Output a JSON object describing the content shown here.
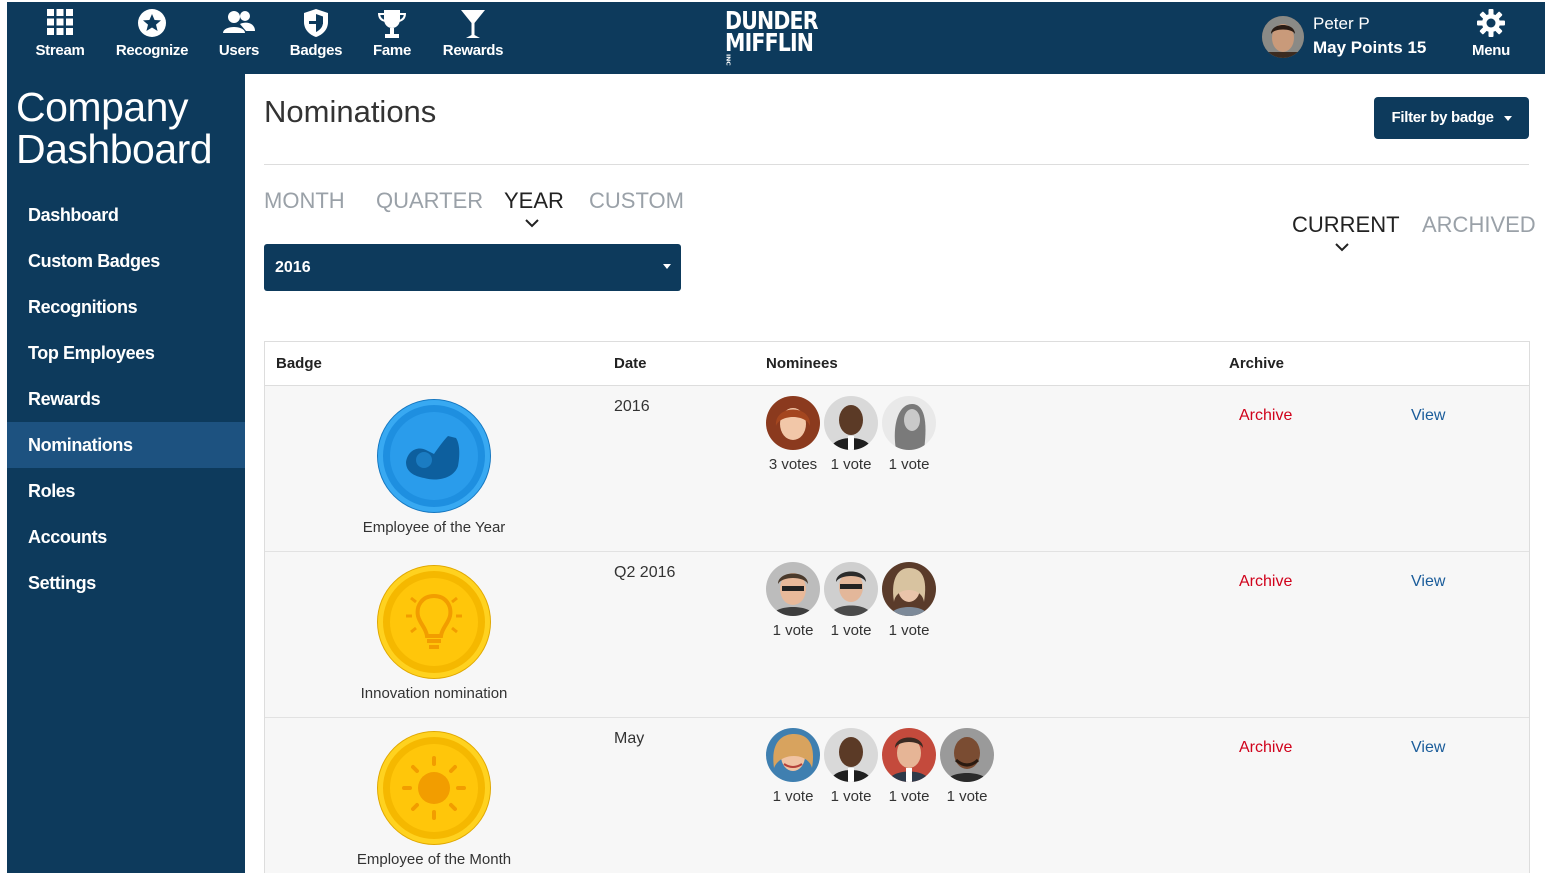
{
  "nav": {
    "items": [
      {
        "label": "Stream",
        "icon": "grid-icon"
      },
      {
        "label": "Recognize",
        "icon": "star-icon"
      },
      {
        "label": "Users",
        "icon": "users-icon"
      },
      {
        "label": "Badges",
        "icon": "shield-icon"
      },
      {
        "label": "Fame",
        "icon": "trophy-icon"
      },
      {
        "label": "Rewards",
        "icon": "cocktail-icon"
      }
    ],
    "logo_line1": "DUNDER",
    "logo_line2": "MIFFLIN",
    "logo_mark": "INC",
    "user_name": "Peter P",
    "user_points": "May Points 15",
    "menu_label": "Menu"
  },
  "sidebar": {
    "title_line1": "Company",
    "title_line2": "Dashboard",
    "items": [
      {
        "label": "Dashboard"
      },
      {
        "label": "Custom Badges"
      },
      {
        "label": "Recognitions"
      },
      {
        "label": "Top Employees"
      },
      {
        "label": "Rewards"
      },
      {
        "label": "Nominations"
      },
      {
        "label": "Roles"
      },
      {
        "label": "Accounts"
      },
      {
        "label": "Settings"
      }
    ],
    "active": "Nominations"
  },
  "main": {
    "title": "Nominations",
    "filter_label": "Filter by badge",
    "period_tabs": [
      "MONTH",
      "QUARTER",
      "YEAR",
      "CUSTOM"
    ],
    "period_active": "YEAR",
    "year_value": "2016",
    "status_tabs": [
      "CURRENT",
      "ARCHIVED"
    ],
    "status_active": "CURRENT"
  },
  "table": {
    "headers": {
      "badge": "Badge",
      "date": "Date",
      "nominees": "Nominees",
      "archive": "Archive"
    },
    "rows": [
      {
        "badge": "Employee of the Year",
        "badge_icon": "flexed-arm-icon",
        "badge_color": "#1e8fe0",
        "date": "2016",
        "nominees": [
          "3 votes",
          "1 vote",
          "1 vote"
        ],
        "archive": "Archive",
        "view": "View"
      },
      {
        "badge": "Innovation nomination",
        "badge_icon": "lightbulb-icon",
        "badge_color": "#f5b800",
        "date": "Q2 2016",
        "nominees": [
          "1 vote",
          "1 vote",
          "1 vote"
        ],
        "archive": "Archive",
        "view": "View"
      },
      {
        "badge": "Employee of the Month",
        "badge_icon": "sun-icon",
        "badge_color": "#f5b800",
        "date": "May",
        "nominees": [
          "1 vote",
          "1 vote",
          "1 vote",
          "1 vote"
        ],
        "archive": "Archive",
        "view": "View"
      }
    ]
  },
  "colors": {
    "navy": "#0d3a5c",
    "sidebar_active": "#1d5280",
    "archive_red": "#d0021b",
    "view_blue": "#1a5c9a"
  }
}
